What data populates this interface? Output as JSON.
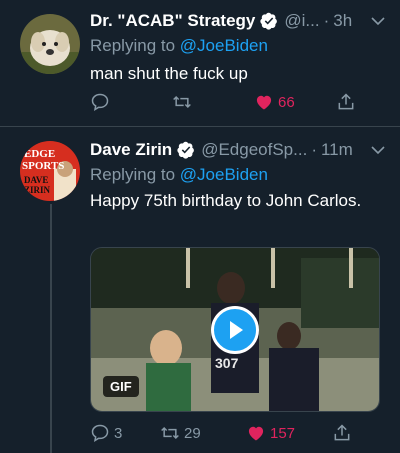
{
  "tweets": [
    {
      "name": "Dr. \"ACAB\" Strategy",
      "handle": "@i...",
      "dot": "·",
      "time": "3h",
      "replying_label": "Replying to",
      "replying_to": "@JoeBiden",
      "text": "man shut the fuck up",
      "replies": "",
      "retweets": "",
      "likes": "66",
      "liked": true
    },
    {
      "name": "Dave Zirin",
      "handle": "@EdgeofSp...",
      "dot": "·",
      "time": "11m",
      "replying_label": "Replying to",
      "replying_to": "@JoeBiden",
      "text": "Happy 75th birthday to John Carlos.",
      "media_badge": "GIF",
      "avatar_text_top": "EDGE",
      "avatar_text_mid": "SPORTS",
      "avatar_text_bot1": "DAVE",
      "avatar_text_bot2": "ZIRIN",
      "jersey_number": "307",
      "replies": "3",
      "retweets": "29",
      "likes": "157",
      "liked": true
    }
  ],
  "colors": {
    "background": "#15202b",
    "accent": "#1da1f2",
    "like": "#e0245e",
    "muted": "#8899a6"
  }
}
